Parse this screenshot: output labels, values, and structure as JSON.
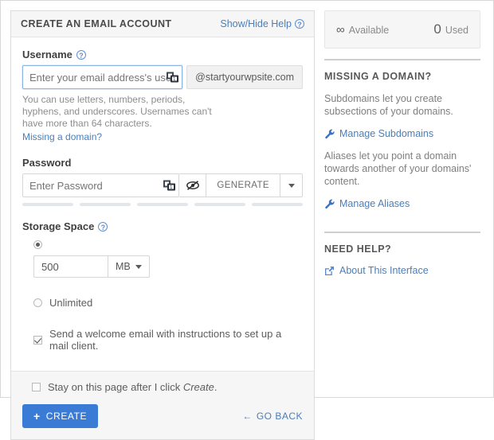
{
  "card": {
    "title": "CREATE AN EMAIL ACCOUNT",
    "help_toggle": "Show/Hide Help",
    "username": {
      "label": "Username",
      "placeholder": "Enter your email address's username here.",
      "value": "",
      "domain_suffix": "@startyourwpsite.com",
      "hint": "You can use letters, numbers, periods, hyphens, and underscores. Usernames can't have more than 64 characters.",
      "missing_domain_link": "Missing a domain?"
    },
    "password": {
      "label": "Password",
      "placeholder": "Enter Password",
      "value": "",
      "generate_label": "GENERATE",
      "strength_segments": 5
    },
    "storage": {
      "label": "Storage Space",
      "quota_selected": true,
      "quota_value": "500",
      "quota_unit": "MB",
      "unlimited_label": "Unlimited",
      "unlimited_selected": false,
      "welcome_email_label": "Send a welcome email with instructions to set up a mail client.",
      "welcome_email_checked": true
    },
    "footer": {
      "stay_on_page_prefix": "Stay on this page after I click ",
      "stay_on_page_emphasis": "Create",
      "stay_on_page_suffix": ".",
      "stay_on_page_checked": false,
      "create_label": "CREATE",
      "create_plus": "+",
      "go_back_label": "GO BACK",
      "go_back_arrow": "←"
    }
  },
  "sidebar": {
    "usage": {
      "available_value": "∞",
      "available_label": "Available",
      "used_value": "0",
      "used_label": "Used"
    },
    "missing_domain": {
      "title": "MISSING A DOMAIN?",
      "subdomain_text": "Subdomains let you create subsections of your domains.",
      "subdomain_link": "Manage Subdomains",
      "alias_text": "Aliases let you point a domain towards another of your domains' content.",
      "alias_link": "Manage Aliases"
    },
    "need_help": {
      "title": "NEED HELP?",
      "link": "About This Interface"
    }
  },
  "colors": {
    "accent_blue": "#3a7bd5",
    "link_blue": "#4a7ebb",
    "panel_gray": "#f6f6f6"
  }
}
